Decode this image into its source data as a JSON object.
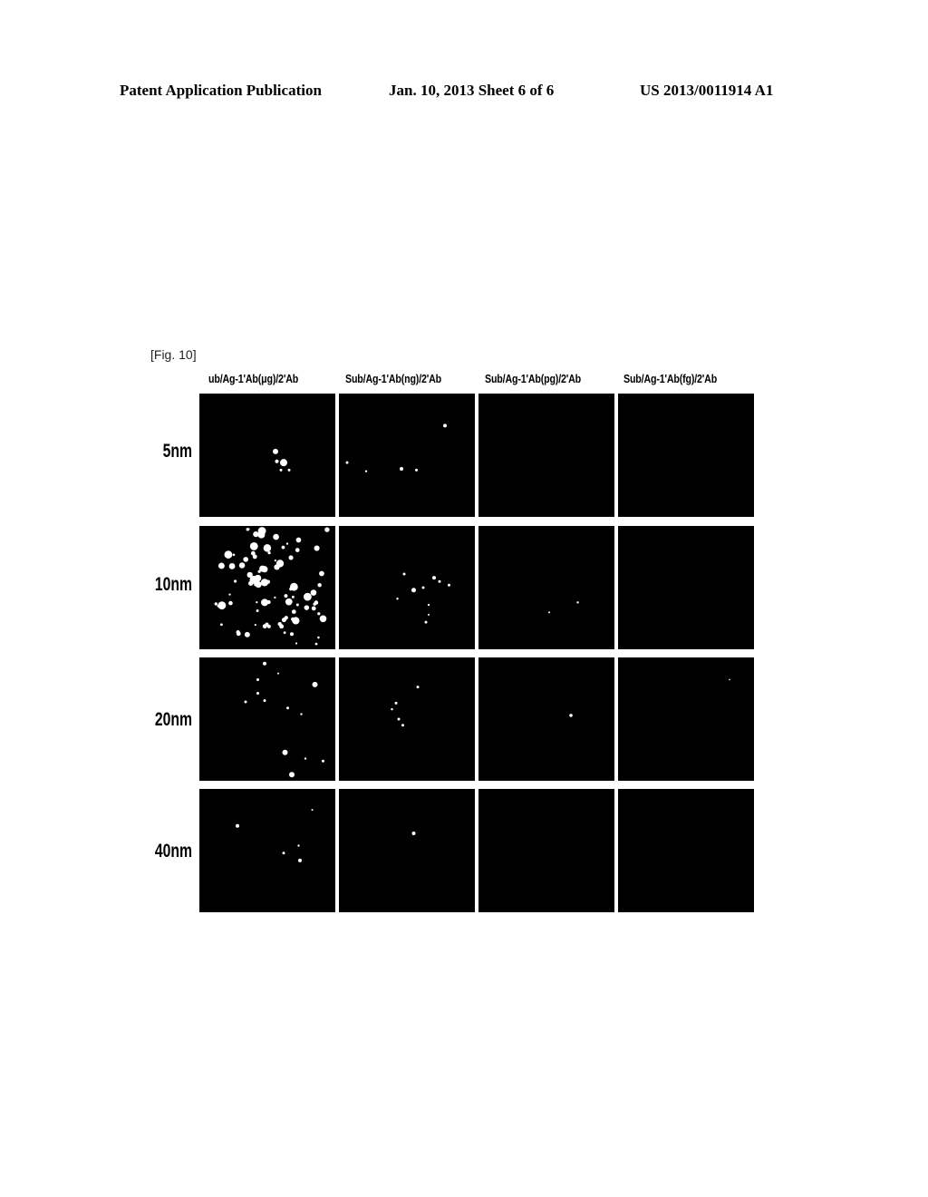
{
  "header": {
    "left": "Patent Application Publication",
    "middle": "Jan. 10, 2013  Sheet 6 of 6",
    "right": "US 2013/0011914 A1"
  },
  "figure": {
    "label": "[Fig. 10]",
    "columns": [
      "ub/Ag-1'Ab(μg)/2'Ab",
      "Sub/Ag-1'Ab(ng)/2'Ab",
      "Sub/Ag-1'Ab(pg)/2'Ab",
      "Sub/Ag-1'Ab(fg)/2'Ab"
    ],
    "rows": [
      "5nm",
      "10nm",
      "20nm",
      "40nm"
    ],
    "panel_background": "#000000",
    "spot_color": "#ffffff",
    "spot_density": [
      [
        "few",
        "sparse",
        "none",
        "none"
      ],
      [
        "dense",
        "few",
        "trace",
        "none"
      ],
      [
        "sparse",
        "few",
        "trace",
        "none"
      ],
      [
        "few",
        "trace",
        "none",
        "none"
      ]
    ]
  }
}
